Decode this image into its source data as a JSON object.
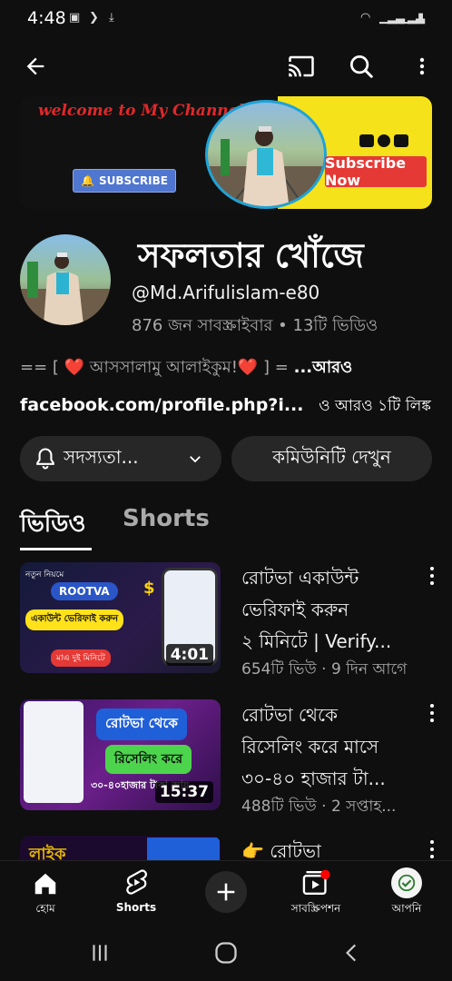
{
  "status_bar": {
    "time": "4:48"
  },
  "banner": {
    "welcome_text": "welcome to My Channel",
    "subscribe_label": "SUBSCRIBE",
    "subscribe_now_label": "Subscribe Now"
  },
  "channel": {
    "name": "সফলতার খোঁজে",
    "handle": "@Md.Arifulislam-e80",
    "stats": "876 জন সাবস্ক্রাইবার • 13টি ভিডিও",
    "description": "== [ ❤️ আসসালামু আলাইকুম!❤️ ] =",
    "description_more": "...আরও",
    "link": "facebook.com/profile.php?i...",
    "link_extra": "ও আরও ১টি লিঙ্ক"
  },
  "actions": {
    "subscription_label": "সদস্যতা...",
    "community_label": "কমিউনিটি দেখুন"
  },
  "tabs": {
    "videos": "ভিডিও",
    "shorts": "Shorts"
  },
  "videos": [
    {
      "title_lines": [
        "রোটভা একাউন্ট",
        "ভেরিফাই করুন",
        "২ মিনিটে | Verify..."
      ],
      "meta": "654টি ভিউ · 9 দিন আগে",
      "duration": "4:01",
      "thumb": {
        "top": "নতুন নিয়মে",
        "brand": "ROOTVA",
        "middle": "একাউন্ট ভেরিফাই করুন",
        "bottom": "মাএ দুই মিনিটে"
      }
    },
    {
      "title_lines": [
        "রোটভা থেকে",
        "রিসেলিং করে মাসে",
        "৩০-৪০ হাজার টা..."
      ],
      "meta": "488টি ভিউ · 2 সপ্তাহ...",
      "duration": "15:37",
      "thumb": {
        "top": "রোটভা থেকে",
        "middle": "রিসেলিং করে",
        "bottom": "৩০-৪০হাজার টাকা আয়"
      }
    },
    {
      "title_lines": [
        "👉 রোটভা"
      ],
      "thumb": {
        "top": "লাইক"
      }
    }
  ],
  "bottom_nav": {
    "home": "হোম",
    "shorts": "Shorts",
    "subscriptions": "সাবস্ক্রিপশন",
    "you": "আপনি"
  },
  "colors": {
    "bg": "#0f0f0f",
    "pill": "#272727",
    "accent_red": "#ff0000"
  }
}
